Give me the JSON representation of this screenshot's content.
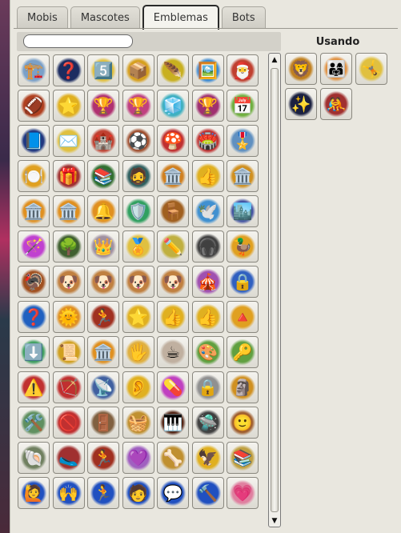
{
  "tabs": [
    {
      "label": "Mobis",
      "active": false
    },
    {
      "label": "Mascotes",
      "active": false
    },
    {
      "label": "Emblemas",
      "active": true
    },
    {
      "label": "Bots",
      "active": false
    }
  ],
  "search": {
    "placeholder": "",
    "value": ""
  },
  "using_title": "Usando",
  "badges": [
    {
      "icon": "🏗️",
      "bg": "#7aa0c8"
    },
    {
      "icon": "❓",
      "bg": "#1c2c60"
    },
    {
      "icon": "5️⃣",
      "bg": "#e0c040"
    },
    {
      "icon": "📦",
      "bg": "#d6a020"
    },
    {
      "icon": "🪶",
      "bg": "#c8b020"
    },
    {
      "icon": "🖼️",
      "bg": "#3a88d0"
    },
    {
      "icon": "🎅",
      "bg": "#c04030"
    },
    {
      "icon": "🏈",
      "bg": "#b04020"
    },
    {
      "icon": "⭐",
      "bg": "#e0b020"
    },
    {
      "icon": "🏆",
      "bg": "#b03070"
    },
    {
      "icon": "🏆",
      "bg": "#c04080"
    },
    {
      "icon": "🧊",
      "bg": "#40b0c0"
    },
    {
      "icon": "🏆",
      "bg": "#a03070"
    },
    {
      "icon": "📅",
      "bg": "#70b040"
    },
    {
      "icon": "📘",
      "bg": "#203880"
    },
    {
      "icon": "✉️",
      "bg": "#e0c040"
    },
    {
      "icon": "🏰",
      "bg": "#c04030"
    },
    {
      "icon": "⚽",
      "bg": "#a05030"
    },
    {
      "icon": "🍄",
      "bg": "#c03030"
    },
    {
      "icon": "🏟️",
      "bg": "#c03030"
    },
    {
      "icon": "🎖️",
      "bg": "#6090c0"
    },
    {
      "icon": "🍽️",
      "bg": "#e0a020"
    },
    {
      "icon": "🎁",
      "bg": "#a03030"
    },
    {
      "icon": "📚",
      "bg": "#307030"
    },
    {
      "icon": "🧔",
      "bg": "#306060"
    },
    {
      "icon": "🏛️",
      "bg": "#d08020"
    },
    {
      "icon": "👍",
      "bg": "#e0b020"
    },
    {
      "icon": "🏛️",
      "bg": "#d09020"
    },
    {
      "icon": "🏛️",
      "bg": "#e09020"
    },
    {
      "icon": "🏛️",
      "bg": "#e09020"
    },
    {
      "icon": "🔔",
      "bg": "#e09020"
    },
    {
      "icon": "🛡️",
      "bg": "#30a060"
    },
    {
      "icon": "🪑",
      "bg": "#a06020"
    },
    {
      "icon": "🕊️",
      "bg": "#4090d0"
    },
    {
      "icon": "🏙️",
      "bg": "#4050a0"
    },
    {
      "icon": "🪄",
      "bg": "#c040d0"
    },
    {
      "icon": "🌳",
      "bg": "#406030"
    },
    {
      "icon": "👑",
      "bg": "#a090a0"
    },
    {
      "icon": "🏅",
      "bg": "#e0c040"
    },
    {
      "icon": "✏️",
      "bg": "#c0b040"
    },
    {
      "icon": "🎧",
      "bg": "#404040"
    },
    {
      "icon": "🦆",
      "bg": "#e0a020"
    },
    {
      "icon": "🦃",
      "bg": "#a05020"
    },
    {
      "icon": "🐶",
      "bg": "#c08040"
    },
    {
      "icon": "🐶",
      "bg": "#c08040"
    },
    {
      "icon": "🐶",
      "bg": "#c08040"
    },
    {
      "icon": "🐶",
      "bg": "#c08040"
    },
    {
      "icon": "🎪",
      "bg": "#a050b0"
    },
    {
      "icon": "🔒",
      "bg": "#3060c0"
    },
    {
      "icon": "❓",
      "bg": "#2060c0"
    },
    {
      "icon": "🌞",
      "bg": "#e09020"
    },
    {
      "icon": "🏃",
      "bg": "#a03020"
    },
    {
      "icon": "⭐",
      "bg": "#e0b020"
    },
    {
      "icon": "👍",
      "bg": "#e0b020"
    },
    {
      "icon": "👍",
      "bg": "#e0b020"
    },
    {
      "icon": "🔺",
      "bg": "#e0a020"
    },
    {
      "icon": "⬇️",
      "bg": "#40a060"
    },
    {
      "icon": "📜",
      "bg": "#d0a020"
    },
    {
      "icon": "🏛️",
      "bg": "#e09020"
    },
    {
      "icon": "🖐️",
      "bg": "#e0b040"
    },
    {
      "icon": "☕",
      "bg": "#c0b0a0"
    },
    {
      "icon": "🎨",
      "bg": "#60a040"
    },
    {
      "icon": "🔑",
      "bg": "#60a040"
    },
    {
      "icon": "⚠️",
      "bg": "#c03030"
    },
    {
      "icon": "🏹",
      "bg": "#c03030"
    },
    {
      "icon": "📡",
      "bg": "#4060a0"
    },
    {
      "icon": "👂",
      "bg": "#e0b020"
    },
    {
      "icon": "💊",
      "bg": "#c040c0"
    },
    {
      "icon": "🔒",
      "bg": "#909090"
    },
    {
      "icon": "🗿",
      "bg": "#d09020"
    },
    {
      "icon": "🛠️",
      "bg": "#609060"
    },
    {
      "icon": "🚫",
      "bg": "#c03030"
    },
    {
      "icon": "🚪",
      "bg": "#806040"
    },
    {
      "icon": "🧺",
      "bg": "#c09030"
    },
    {
      "icon": "🎹",
      "bg": "#502010"
    },
    {
      "icon": "🛸",
      "bg": "#404040"
    },
    {
      "icon": "🙂",
      "bg": "#a06030"
    },
    {
      "icon": "🐚",
      "bg": "#708060"
    },
    {
      "icon": "🥿",
      "bg": "#a03030"
    },
    {
      "icon": "🏃",
      "bg": "#a03020"
    },
    {
      "icon": "💜",
      "bg": "#a060c0"
    },
    {
      "icon": "🦴",
      "bg": "#c09030"
    },
    {
      "icon": "🦅",
      "bg": "#e0b020"
    },
    {
      "icon": "📚",
      "bg": "#c0a040"
    },
    {
      "icon": "🙋",
      "bg": "#2050c0"
    },
    {
      "icon": "🙌",
      "bg": "#2050c0"
    },
    {
      "icon": "🏃",
      "bg": "#2050c0"
    },
    {
      "icon": "🧑",
      "bg": "#2050c0"
    },
    {
      "icon": "💬",
      "bg": "#2050c0"
    },
    {
      "icon": "🔨",
      "bg": "#2050c0"
    },
    {
      "icon": "💗",
      "bg": "#e080a0"
    }
  ],
  "using": [
    {
      "icon": "🦁",
      "bg": "#c08020"
    },
    {
      "icon": "👨‍👩‍👧",
      "bg": "#e09040"
    },
    {
      "icon": "🤸",
      "bg": "#e0c040"
    },
    {
      "icon": "✨",
      "bg": "#1a2040"
    },
    {
      "icon": "🤼",
      "bg": "#a03030"
    }
  ]
}
